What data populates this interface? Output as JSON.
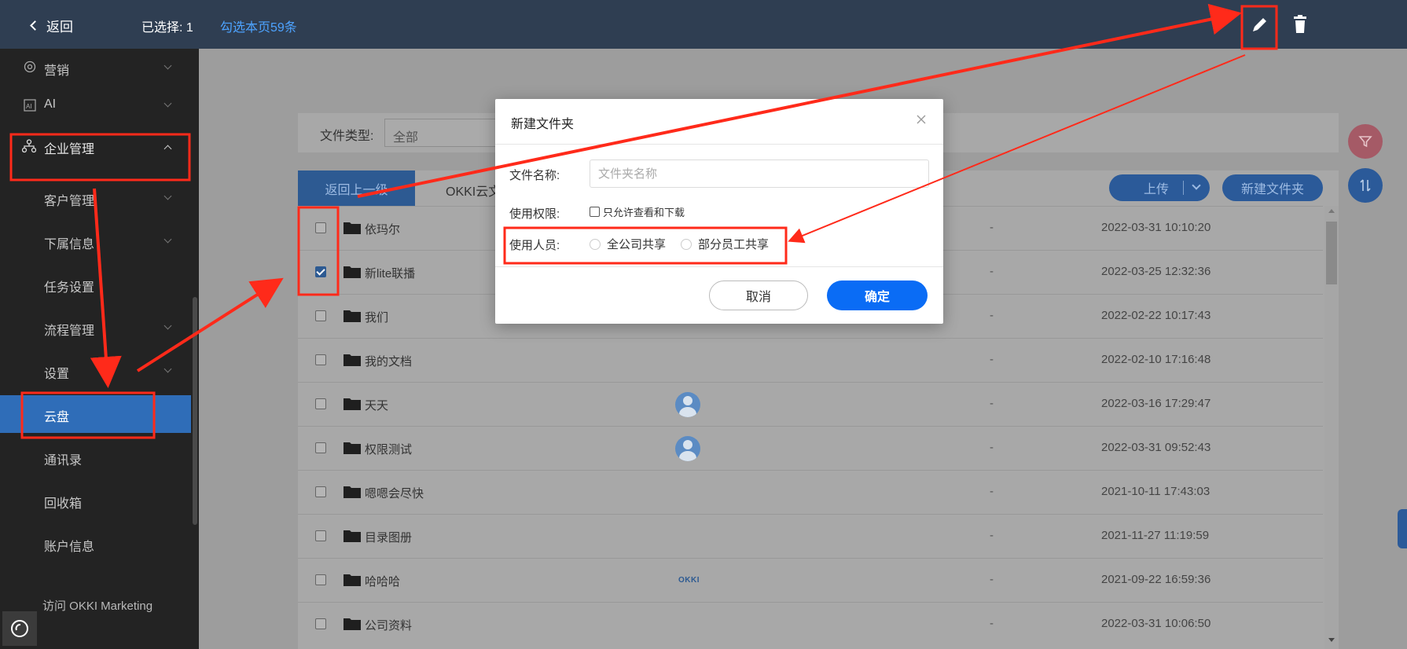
{
  "topbar": {
    "back_label": "返回",
    "selected_text": "已选择:  1",
    "select_page_label": "勾选本页59条"
  },
  "sidebar": {
    "items": [
      {
        "label": "营销",
        "icon": "target-icon",
        "expandable": true
      },
      {
        "label": "AI",
        "icon": "ai-icon",
        "expandable": true
      },
      {
        "label": "企业管理",
        "icon": "org-icon",
        "expandable": true,
        "expanded": true
      },
      {
        "label": "客户管理",
        "expandable": true
      },
      {
        "label": "下属信息",
        "expandable": true
      },
      {
        "label": "任务设置",
        "expandable": false
      },
      {
        "label": "流程管理",
        "expandable": true
      },
      {
        "label": "设置",
        "expandable": true
      },
      {
        "label": "云盘",
        "active": true
      },
      {
        "label": "通讯录"
      },
      {
        "label": "回收箱"
      },
      {
        "label": "账户信息"
      }
    ],
    "visit_link": "访问 OKKI Marketing"
  },
  "filter": {
    "type_label": "文件类型:",
    "type_value": "全部"
  },
  "list": {
    "back_up_label": "返回上一级",
    "tab_label": "OKKI云文",
    "upload_label": "上传",
    "new_folder_label": "新建文件夹",
    "rows": [
      {
        "name": "依玛尔",
        "checked": false,
        "owner": "",
        "dash": "-",
        "date": "2022-03-31 10:10:20"
      },
      {
        "name": "新lite联播",
        "checked": true,
        "owner": "",
        "dash": "-",
        "date": "2022-03-25 12:32:36"
      },
      {
        "name": "我们",
        "checked": false,
        "owner": "",
        "dash": "-",
        "date": "2022-02-22 10:17:43"
      },
      {
        "name": "我的文档",
        "checked": false,
        "owner": "",
        "dash": "-",
        "date": "2022-02-10 17:16:48"
      },
      {
        "name": "天天",
        "checked": false,
        "owner": "avatar",
        "dash": "-",
        "date": "2022-03-16 17:29:47"
      },
      {
        "name": "权限测试",
        "checked": false,
        "owner": "avatar",
        "dash": "-",
        "date": "2022-03-31 09:52:43"
      },
      {
        "name": "嗯嗯会尽快",
        "checked": false,
        "owner": "",
        "dash": "-",
        "date": "2021-10-11 17:43:03"
      },
      {
        "name": "目录图册",
        "checked": false,
        "owner": "",
        "dash": "-",
        "date": "2021-11-27 11:19:59"
      },
      {
        "name": "哈哈哈",
        "checked": false,
        "owner": "okki",
        "okki_text": "OKKI",
        "dash": "-",
        "date": "2021-09-22 16:59:36"
      },
      {
        "name": "公司资料",
        "checked": false,
        "owner": "",
        "dash": "-",
        "date": "2022-03-31 10:06:50"
      }
    ]
  },
  "modal": {
    "title": "新建文件夹",
    "name_label": "文件名称:",
    "name_placeholder": "文件夹名称",
    "perm_label": "使用权限:",
    "perm_option": "只允许查看和下载",
    "users_label": "使用人员:",
    "radio_all": "全公司共享",
    "radio_some": "部分员工共享",
    "cancel_label": "取消",
    "ok_label": "确定"
  },
  "colors": {
    "topbar_bg": "#2f3e52",
    "sidebar_bg": "#232323",
    "active_blue": "#2f6db8",
    "primary_button": "#0a6cf5",
    "annotation_red": "#ff2a1a"
  }
}
